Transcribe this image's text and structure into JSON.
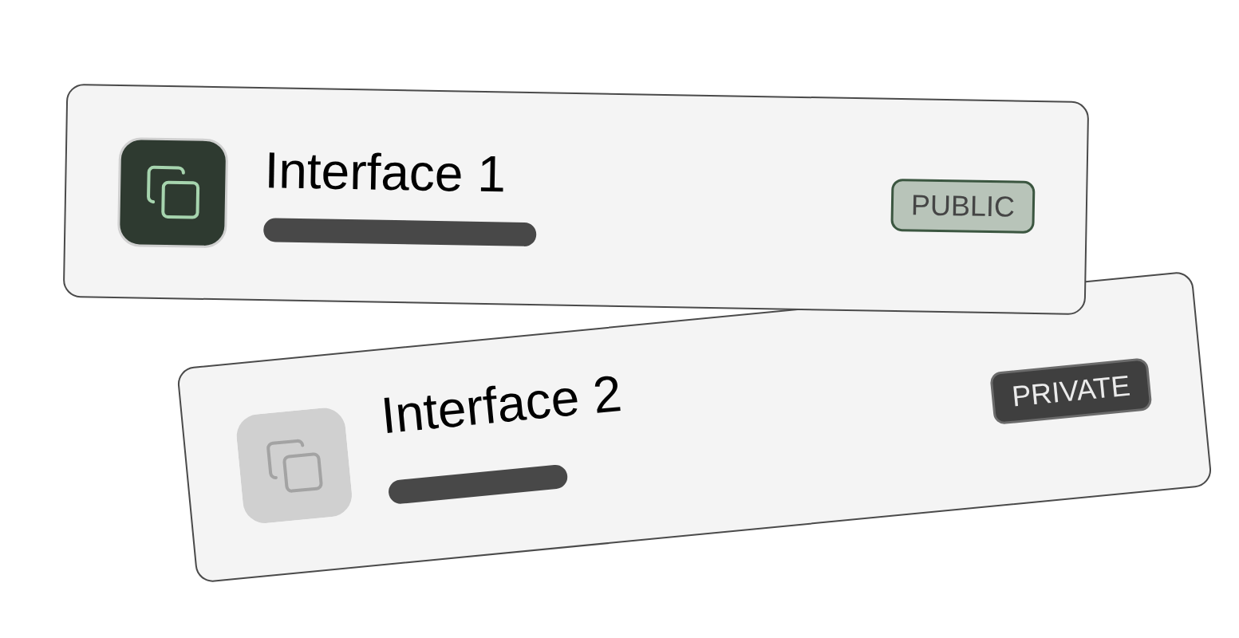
{
  "cards": [
    {
      "title": "Interface 1",
      "active": true,
      "badge": {
        "label": "PUBLIC",
        "kind": "public"
      }
    },
    {
      "title": "Interface 2",
      "active": false,
      "badge": {
        "label": "PRIVATE",
        "kind": "private"
      }
    }
  ]
}
